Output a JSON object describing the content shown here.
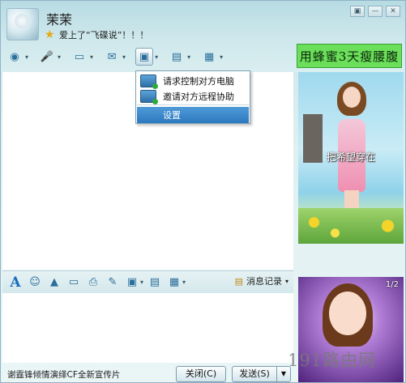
{
  "header": {
    "contact_name": "茉茉",
    "status_message": "爱上了“飞碟说”！！！",
    "window_controls": [
      "▣",
      "—",
      "✕"
    ]
  },
  "toolbar": {
    "icons": [
      "webcam-icon",
      "microphone-icon",
      "file-transfer-icon",
      "message-icon",
      "remote-assist-icon",
      "screenshot-icon",
      "apps-icon"
    ]
  },
  "banner": {
    "text": "用蜂蜜3天瘦腰腹"
  },
  "ad_panel": {
    "caption": "把希望穿在"
  },
  "menu": {
    "items": [
      {
        "label": "请求控制对方电脑"
      },
      {
        "label": "邀请对方远程协助"
      },
      {
        "label": "设置"
      }
    ]
  },
  "input_toolbar": {
    "history_label": "消息记录"
  },
  "bottom": {
    "tip": "谢霆锋倾情演绎CF全新宣传片",
    "close_label": "关闭(C)",
    "send_label": "发送(S)"
  },
  "ad2": {
    "page": "1/2"
  },
  "watermark": "191路由网"
}
